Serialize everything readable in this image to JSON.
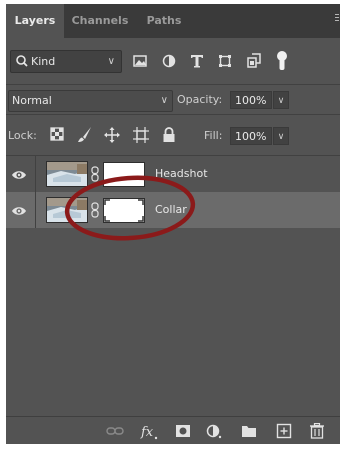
{
  "tabs": [
    {
      "label": "Layers",
      "active": true
    },
    {
      "label": "Channels",
      "active": false
    },
    {
      "label": "Paths",
      "active": false
    }
  ],
  "filter": {
    "kind_label": "Kind",
    "icons": [
      "image-filter-icon",
      "adjustment-filter-icon",
      "type-filter-icon",
      "shape-filter-icon",
      "smart-object-filter-icon",
      "filter-toggle-icon"
    ]
  },
  "blend": {
    "mode": "Normal",
    "opacity_label": "Opacity:",
    "opacity_value": "100%"
  },
  "lock": {
    "label": "Lock:",
    "icons": [
      "lock-transparent-pixels-icon",
      "lock-image-pixels-icon",
      "lock-position-icon",
      "lock-artboard-icon",
      "lock-all-icon"
    ],
    "fill_label": "Fill:",
    "fill_value": "100%"
  },
  "layers": [
    {
      "name": "Headshot",
      "visible": true,
      "selected": false
    },
    {
      "name": "Collar",
      "visible": true,
      "selected": true
    }
  ],
  "bottom_icons": [
    "link-layers-icon",
    "layer-style-fx-icon",
    "add-mask-icon",
    "adjustment-layer-icon",
    "new-group-icon",
    "new-layer-icon",
    "delete-layer-icon"
  ],
  "annotation": {
    "color": "#8b1a1a",
    "shape": "ellipse",
    "target": "Collar layer mask"
  }
}
